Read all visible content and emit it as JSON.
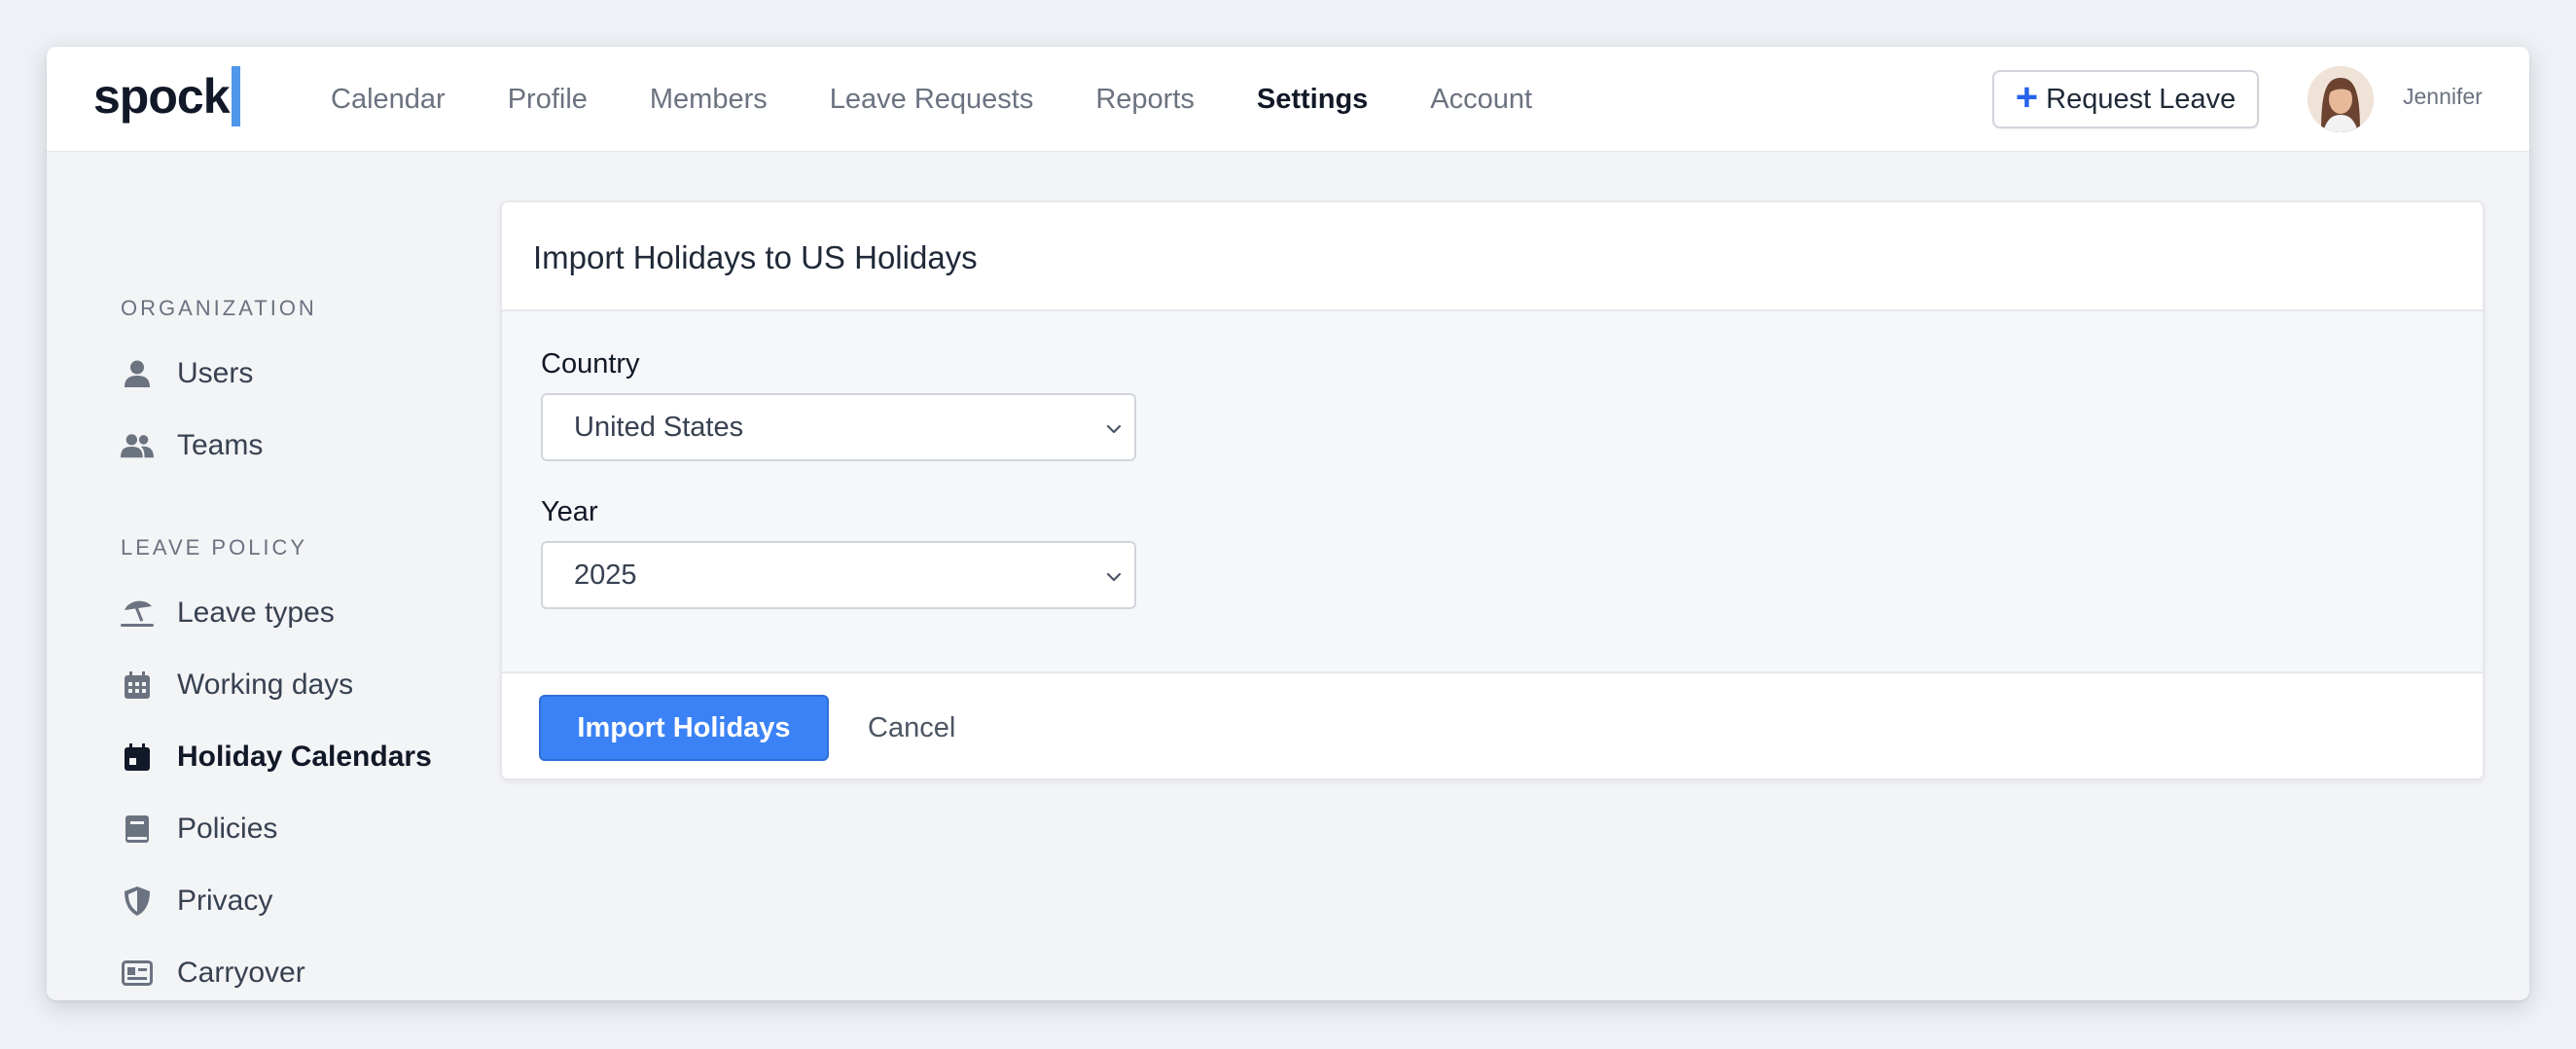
{
  "header": {
    "logo": "spock",
    "nav": [
      {
        "label": "Calendar",
        "active": false
      },
      {
        "label": "Profile",
        "active": false
      },
      {
        "label": "Members",
        "active": false
      },
      {
        "label": "Leave Requests",
        "active": false
      },
      {
        "label": "Reports",
        "active": false
      },
      {
        "label": "Settings",
        "active": true
      },
      {
        "label": "Account",
        "active": false
      }
    ],
    "request_button": {
      "icon": "plus-icon",
      "label": "Request Leave"
    },
    "user": {
      "avatar": "avatar",
      "name": "Jennifer"
    }
  },
  "sidebar": {
    "organization_heading": "ORGANIZATION",
    "organization_items": [
      {
        "label": "Users",
        "icon": "user-icon"
      },
      {
        "label": "Teams",
        "icon": "users-icon"
      }
    ],
    "leave_policy_heading": "LEAVE POLICY",
    "leave_policy_items": [
      {
        "label": "Leave types",
        "icon": "beach-umbrella-icon"
      },
      {
        "label": "Working days",
        "icon": "calendar-grid-icon"
      },
      {
        "label": "Holiday Calendars",
        "icon": "calendar-day-icon",
        "active": true
      },
      {
        "label": "Policies",
        "icon": "book-icon"
      },
      {
        "label": "Privacy",
        "icon": "shield-icon"
      },
      {
        "label": "Carryover",
        "icon": "id-card-icon"
      }
    ]
  },
  "panel": {
    "title": "Import Holidays to US Holidays",
    "country": {
      "label": "Country",
      "value": "United States"
    },
    "year": {
      "label": "Year",
      "value": "2025"
    },
    "import_button": "Import Holidays",
    "cancel": "Cancel"
  },
  "colors": {
    "accent": "#3b82f6",
    "logo_bar": "#4f97ea",
    "plus": "#2563eb"
  }
}
